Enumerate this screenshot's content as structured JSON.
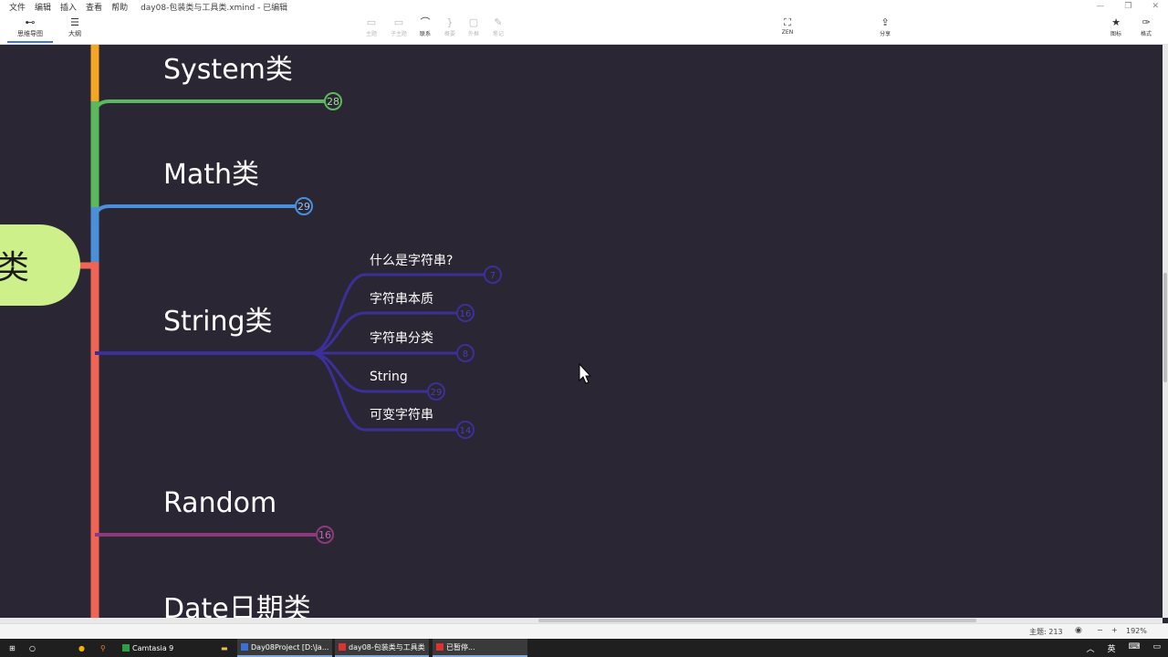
{
  "window": {
    "menu": [
      "文件",
      "编辑",
      "插入",
      "查看",
      "帮助"
    ],
    "title": "day08-包装类与工具类.xmind - 已编辑"
  },
  "view_tabs": [
    {
      "label": "思维导图",
      "icon": "mindmap-icon",
      "active": true
    },
    {
      "label": "大纲",
      "icon": "outline-icon",
      "active": false
    }
  ],
  "toolbar": {
    "tools": [
      {
        "label": "主题",
        "icon": "topic-icon",
        "enabled": false
      },
      {
        "label": "子主题",
        "icon": "subtopic-icon",
        "enabled": false
      },
      {
        "label": "联系",
        "icon": "relationship-icon",
        "enabled": true
      },
      {
        "label": "概要",
        "icon": "summary-icon",
        "enabled": false
      },
      {
        "label": "外框",
        "icon": "boundary-icon",
        "enabled": false
      },
      {
        "label": "笔记",
        "icon": "note-icon",
        "enabled": false
      }
    ],
    "zen": "ZEN",
    "share": "分享",
    "icons_label": "图标",
    "format_label": "格式"
  },
  "mindmap": {
    "root_label": "类",
    "branches": [
      {
        "label": "System类",
        "badge": "28",
        "color": "#5cb85c"
      },
      {
        "label": "Math类",
        "badge": "29",
        "color": "#4a8fd8"
      },
      {
        "label": "String类",
        "badge": "",
        "color": "#3b2f9a",
        "children": [
          {
            "label": "什么是字符串?",
            "badge": "7"
          },
          {
            "label": "字符串本质",
            "badge": "16"
          },
          {
            "label": "字符串分类",
            "badge": "8"
          },
          {
            "label": "String",
            "badge": "29"
          },
          {
            "label": "可变字符串",
            "badge": "14"
          }
        ]
      },
      {
        "label": "Random",
        "badge": "16",
        "color": "#8a3c7a"
      },
      {
        "label": "Date日期类",
        "badge": "",
        "color": "#f06455"
      }
    ],
    "colors": {
      "background": "#2b2633",
      "root_fill": "#cdf08a",
      "trunk_top": "#f5a623",
      "trunk_green": "#5cb85c",
      "trunk_blue": "#4a8fd8",
      "trunk_red": "#f06455"
    }
  },
  "status": {
    "topic_count": "主题: 213",
    "zoom": "192%"
  },
  "taskbar": {
    "items": [
      {
        "label": "Camtasia 9",
        "color": "#2f9e44"
      },
      {
        "label": "Day08Project [D:\\Ja...",
        "color": "#3a6fd8"
      },
      {
        "label": "day08-包装类与工具类",
        "color": "#e03131"
      },
      {
        "label": "已暂停...",
        "color": "#e03131"
      }
    ],
    "ime": "英"
  }
}
